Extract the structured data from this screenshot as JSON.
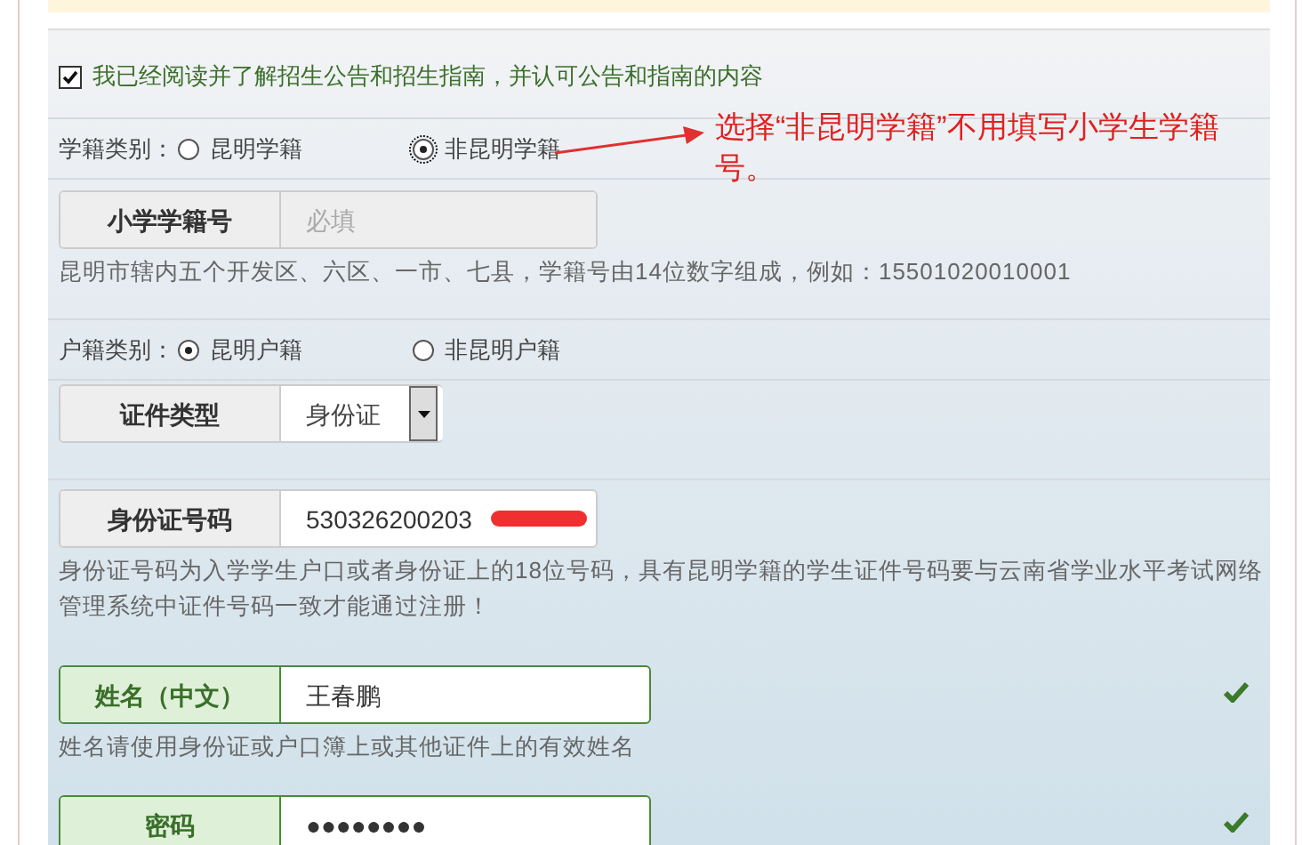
{
  "sections": [
    {
      "kind": "checkbox",
      "checked": true,
      "text": "我已经阅读并了解招生公告和招生指南，并认可公告和指南的内容"
    },
    {
      "kind": "radio",
      "label": "学籍类别：",
      "options": [
        {
          "label": "昆明学籍",
          "selected": false
        },
        {
          "label": "非昆明学籍",
          "selected": true
        }
      ]
    },
    {
      "kind": "input",
      "label": "小学学籍号",
      "placeholder": "必填",
      "disabled": true,
      "hint": "昆明市辖内五个开发区、六区、一市、七县，学籍号由14位数字组成，例如：15501020010001"
    },
    {
      "kind": "radio",
      "label": "户籍类别：",
      "options": [
        {
          "label": "昆明户籍",
          "selected": true
        },
        {
          "label": "非昆明户籍",
          "selected": false
        }
      ]
    },
    {
      "kind": "select",
      "label": "证件类型",
      "value": "身份证"
    },
    {
      "kind": "input",
      "label": "身份证号码",
      "value": "530326200203",
      "redacted": true,
      "hint": "身份证号码为入学学生户口或者身份证上的18位号码，具有昆明学籍的学生证件号码要与云南省学业水平考试网络管理系统中证件号码一致才能通过注册！"
    },
    {
      "kind": "input",
      "label": "姓名（中文）",
      "value": "王春鹏",
      "valid": true,
      "hint": "姓名请使用身份证或户口簿上或其他证件上的有效姓名"
    },
    {
      "kind": "input",
      "label": "密码",
      "value": "●●●●●●●●",
      "valid": true
    }
  ],
  "annotation": {
    "text": "选择“非昆明学籍”不用填写小学生学籍号。"
  }
}
